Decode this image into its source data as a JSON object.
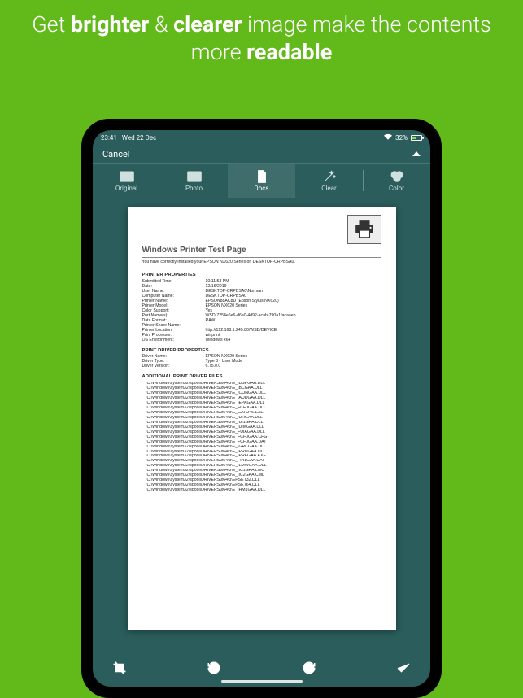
{
  "headline": {
    "part1": "Get ",
    "bold1": "brighter",
    "part2": " & ",
    "bold2": "clearer",
    "part3": " image make the contents more ",
    "bold3": "readable"
  },
  "statusbar": {
    "time": "23:41",
    "date": "Wed 22 Dec",
    "battery_pct": "32%"
  },
  "topnav": {
    "cancel": "Cancel"
  },
  "tabs": [
    {
      "id": "original",
      "label": "Original",
      "selected": false,
      "icon": "image-icon"
    },
    {
      "id": "photo",
      "label": "Photo",
      "selected": false,
      "icon": "image-icon"
    },
    {
      "id": "docs",
      "label": "Docs",
      "selected": true,
      "icon": "document-icon"
    },
    {
      "id": "clear",
      "label": "Clear",
      "selected": false,
      "icon": "magic-wand-icon"
    },
    {
      "id": "color",
      "label": "Color",
      "selected": false,
      "icon": "venn-icon"
    }
  ],
  "doc": {
    "title": "Windows Printer Test Page",
    "intro": "You have correctly installed your EPSON NX620 Series on DESKTOP-CRPBSA0.",
    "section1": "PRINTER PROPERTIES",
    "printer_props": [
      [
        "Submitted Time:",
        "10:11:53 PM"
      ],
      [
        "Date:",
        "12/16/2019"
      ],
      [
        "User Name:",
        "DESKTOP-CRPBSA0\\Norman"
      ],
      [
        "Computer Name:",
        "DESKTOP-CRPBSA0"
      ],
      [
        "Printer Name:",
        "EPSON88AC8D (Epson Stylus NX620)"
      ],
      [
        "Printer Model:",
        "EPSON NX620 Series"
      ],
      [
        "Color Support:",
        "Yes"
      ],
      [
        "Port Name(s):",
        "WSD-7254e6e6-d6a0-4d92-acab-790a1facaaeb"
      ],
      [
        "Data Format:",
        "RAW"
      ],
      [
        "Printer Share Name:",
        ""
      ],
      [
        "Printer Location:",
        "http://192.168.1.245:80/WSD/DEVICE"
      ],
      [
        "Print Processor:",
        "winprint"
      ],
      [
        "OS Environment:",
        "Windows x64"
      ]
    ],
    "section2": "PRINT DRIVER PROPERTIES",
    "driver_props": [
      [
        "Driver Name:",
        "EPSON NX620 Series"
      ],
      [
        "Driver Type:",
        "Type 3 - User Mode"
      ],
      [
        "Driver Version:",
        "6.75.0.0"
      ]
    ],
    "section3": "ADDITIONAL PRINT DRIVER FILES",
    "driver_files": [
      "C:\\Windows\\system32\\spool\\DRIVERS\\x64\\3\\E_IDSPGAA.DLL",
      "C:\\Windows\\system32\\spool\\DRIVERS\\x64\\3\\E_IBCGAA.DLL",
      "C:\\Windows\\system32\\spool\\DRIVERS\\x64\\3\\E_ICONGAA.DLL",
      "C:\\Windows\\system32\\spool\\DRIVERS\\x64\\3\\E_IAUDGAA.DLL",
      "C:\\Windows\\system32\\spool\\DRIVERS\\x64\\3\\E_IEPAGAA.DLL",
      "C:\\Windows\\system32\\spool\\DRIVERS\\x64\\3\\E_FCF0GAA.DLL",
      "C:\\Windows\\system32\\spool\\DRIVERS\\x64\\3\\E_GATO46.EXE",
      "C:\\Windows\\system32\\spool\\DRIVERS\\x64\\3\\E_IURGAA.DLL",
      "C:\\Windows\\system32\\spool\\DRIVERS\\x64\\3\\E_IUI1GAA.DLL",
      "C:\\Windows\\system32\\spool\\DRIVERS\\x64\\3\\E_IUIMGAA.DLL",
      "C:\\Windows\\system32\\spool\\DRIVERS\\x64\\3\\E_FUIAGAA.DLL",
      "C:\\Windows\\system32\\spool\\DRIVERS\\x64\\3\\E_FCF0GAA.CFG",
      "C:\\Windows\\system32\\spool\\DRIVERS\\x64\\3\\E_FCF0GAA.DAT",
      "C:\\Windows\\system32\\spool\\DRIVERS\\x64\\3\\E_IGRCGAA.DLL",
      "C:\\Windows\\system32\\spool\\DRIVERS\\x64\\3\\E_IPRUGAA.DLL",
      "C:\\Windows\\system32\\spool\\DRIVERS\\x64\\3\\E_IPREGAA.EXE",
      "C:\\Windows\\system32\\spool\\DRIVERS\\x64\\3\\E_FPI1GAA.DAT",
      "C:\\Windows\\system32\\spool\\DRIVERS\\x64\\3\\E_ILMWGAA.DLL",
      "C:\\Windows\\system32\\spool\\DRIVERS\\x64\\3\\E_IIC1GAA.LMC",
      "C:\\Windows\\system32\\spool\\DRIVERS\\x64\\3\\E_IIC2GAA.CML",
      "C:\\Windows\\system32\\spool\\DRIVERS\\x64\\3\\EPSET32.DLL",
      "C:\\Windows\\system32\\spool\\DRIVERS\\x64\\3\\EPSET64.DLL",
      "C:\\Windows\\system32\\spool\\DRIVERS\\x64\\3\\E_IHM1GAA.DLL"
    ]
  },
  "toolbar": {
    "crop": "crop",
    "rotate_left": "rotate-left",
    "rotate_right": "rotate-right",
    "confirm": "confirm"
  }
}
